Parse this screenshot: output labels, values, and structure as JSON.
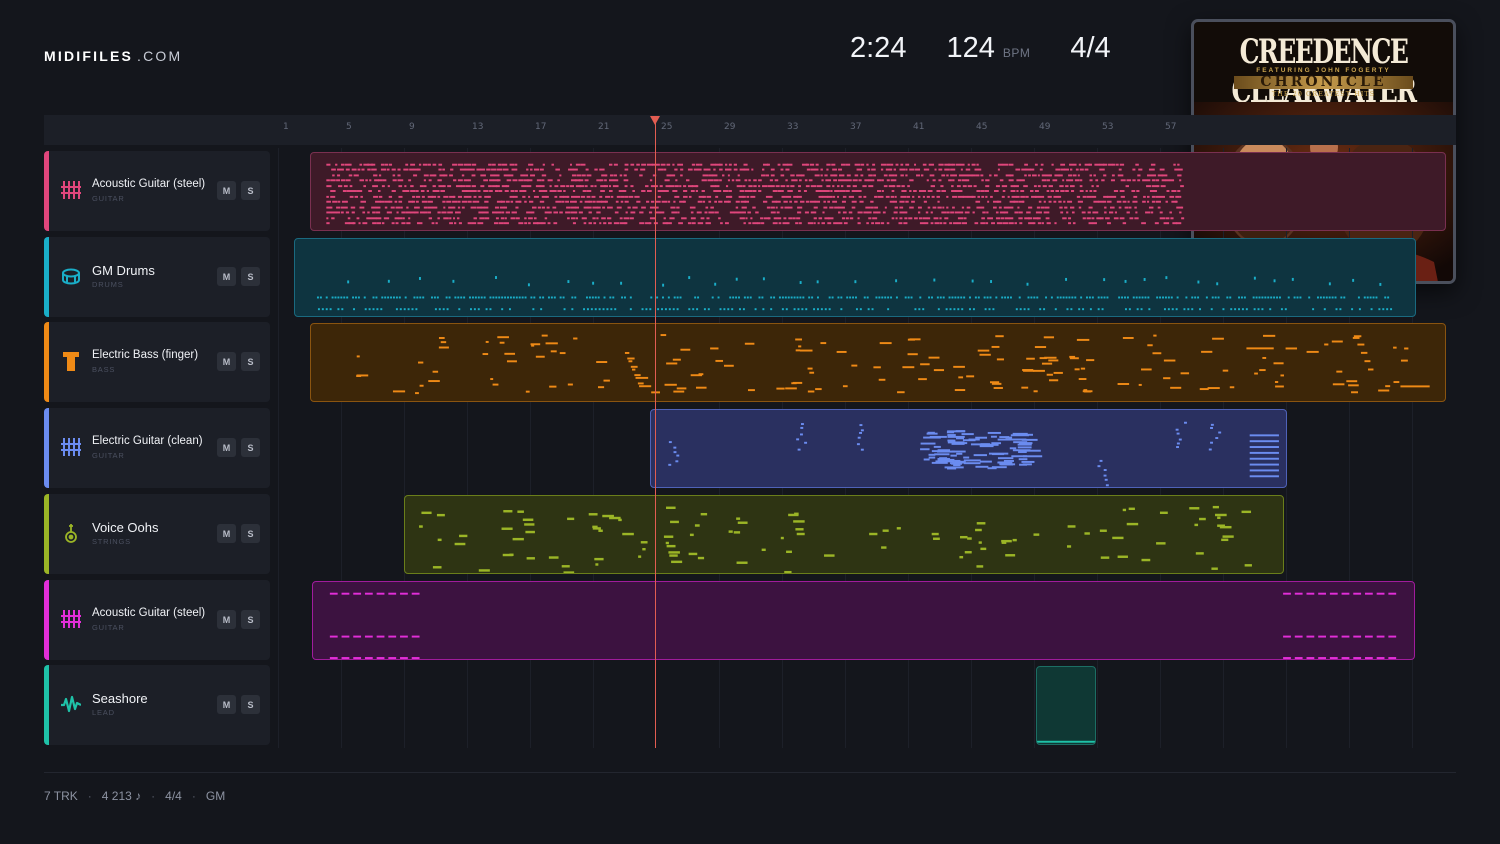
{
  "brand": {
    "bold": "MIDIFILES",
    "light": ".COM"
  },
  "transport": {
    "time": "2:24",
    "bpm": "124",
    "bpm_unit": "BPM",
    "signature": "4/4"
  },
  "album": {
    "title": "CREEDENCE CLEARWATER REVIVAL",
    "featuring": "FEATURING JOHN FOGERTY",
    "name": "CHRONICLE",
    "subtitle": "THE 20 GREATEST HITS"
  },
  "ruler": {
    "bars": [
      "1",
      "5",
      "9",
      "13",
      "17",
      "21",
      "25",
      "29",
      "33",
      "37",
      "41",
      "45",
      "49",
      "53",
      "57"
    ]
  },
  "tracks": [
    {
      "name": "Acoustic Guitar (steel)",
      "category": "GUITAR",
      "color": "#e0467c",
      "icon": "guitar-grid-icon",
      "mute": "M",
      "solo": "S"
    },
    {
      "name": "GM Drums",
      "category": "DRUMS",
      "color": "#1aaec8",
      "icon": "drum-icon",
      "mute": "M",
      "solo": "S"
    },
    {
      "name": "Electric Bass (finger)",
      "category": "BASS",
      "color": "#ef8a16",
      "icon": "bass-icon",
      "mute": "M",
      "solo": "S"
    },
    {
      "name": "Electric Guitar (clean)",
      "category": "GUITAR",
      "color": "#6b8cf0",
      "icon": "guitar-grid-icon",
      "mute": "M",
      "solo": "S"
    },
    {
      "name": "Voice Oohs",
      "category": "STRINGS",
      "color": "#9bb526",
      "icon": "voice-icon",
      "mute": "M",
      "solo": "S"
    },
    {
      "name": "Acoustic Guitar (steel)",
      "category": "GUITAR",
      "color": "#e22ed8",
      "icon": "guitar-grid-icon",
      "mute": "M",
      "solo": "S"
    },
    {
      "name": "Seashore",
      "category": "LEAD",
      "color": "#1fc2a8",
      "icon": "wave-icon",
      "mute": "M",
      "solo": "S"
    }
  ],
  "footer": {
    "tracks": "7 TRK",
    "notes": "4 213 ♪",
    "signature": "4/4",
    "standard": "GM"
  }
}
